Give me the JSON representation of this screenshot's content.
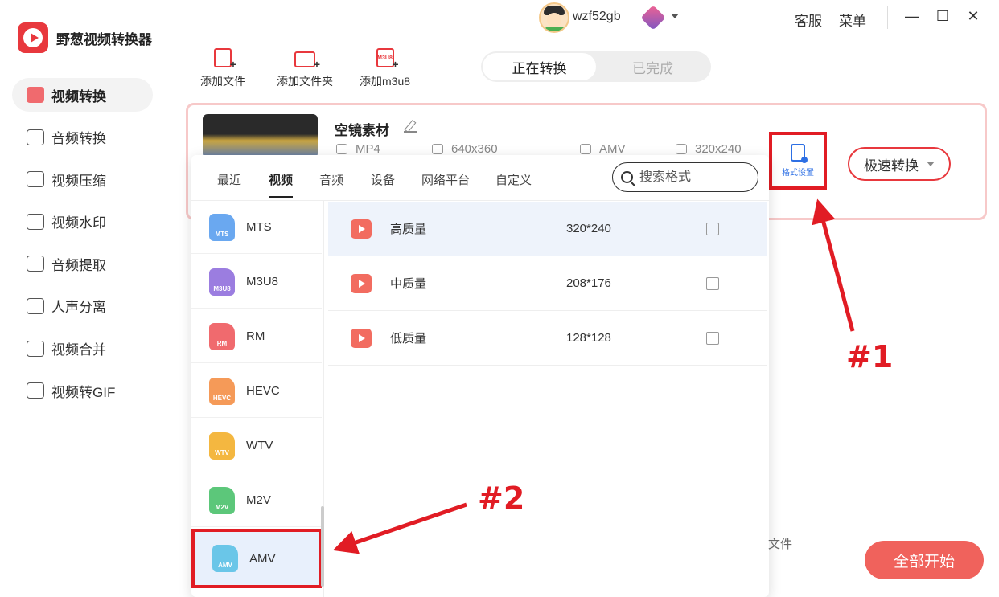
{
  "app": {
    "title": "野葱视频转换器"
  },
  "sidebar": {
    "items": [
      {
        "label": "视频转换",
        "active": true
      },
      {
        "label": "音频转换"
      },
      {
        "label": "视频压缩"
      },
      {
        "label": "视频水印"
      },
      {
        "label": "音频提取"
      },
      {
        "label": "人声分离"
      },
      {
        "label": "视频合并"
      },
      {
        "label": "视频转GIF"
      }
    ]
  },
  "topbar": {
    "username": "wzf52gb",
    "service": "客服",
    "menu": "菜单"
  },
  "toolbar": {
    "add_file": "添加文件",
    "add_folder": "添加文件夹",
    "add_m3u8": "添加m3u8",
    "m3u8_badge": "M3U8"
  },
  "status_tabs": {
    "converting": "正在转换",
    "done": "已完成"
  },
  "file": {
    "name": "空镜素材",
    "src_format": "MP4",
    "src_res": "640x360",
    "dst_format": "AMV",
    "dst_res": "320x240"
  },
  "format_settings_label": "格式设置",
  "fast_convert_label": "极速转换",
  "popup": {
    "tabs": [
      "最近",
      "视频",
      "音频",
      "设备",
      "网络平台",
      "自定义"
    ],
    "active_tab": "视频",
    "search_placeholder": "搜索格式",
    "formats": [
      {
        "name": "MTS",
        "color": "#6aa8f0"
      },
      {
        "name": "M3U8",
        "color": "#9b7de0"
      },
      {
        "name": "RM",
        "color": "#f06a6e"
      },
      {
        "name": "HEVC",
        "color": "#f59a58"
      },
      {
        "name": "WTV",
        "color": "#f4b740"
      },
      {
        "name": "M2V",
        "color": "#5cc77a"
      },
      {
        "name": "AMV",
        "color": "#6ac6e8",
        "selected": true
      }
    ],
    "qualities": [
      {
        "name": "高质量",
        "res": "320*240"
      },
      {
        "name": "中质量",
        "res": "208*176"
      },
      {
        "name": "低质量",
        "res": "128*128"
      }
    ]
  },
  "bottom": {
    "file_label": "文件",
    "start_all": "全部开始"
  },
  "annotations": {
    "one": "#1",
    "two": "#2"
  },
  "colors": {
    "accent": "#e8383d",
    "highlight": "#e11c24",
    "link_blue": "#2d6fe4"
  }
}
